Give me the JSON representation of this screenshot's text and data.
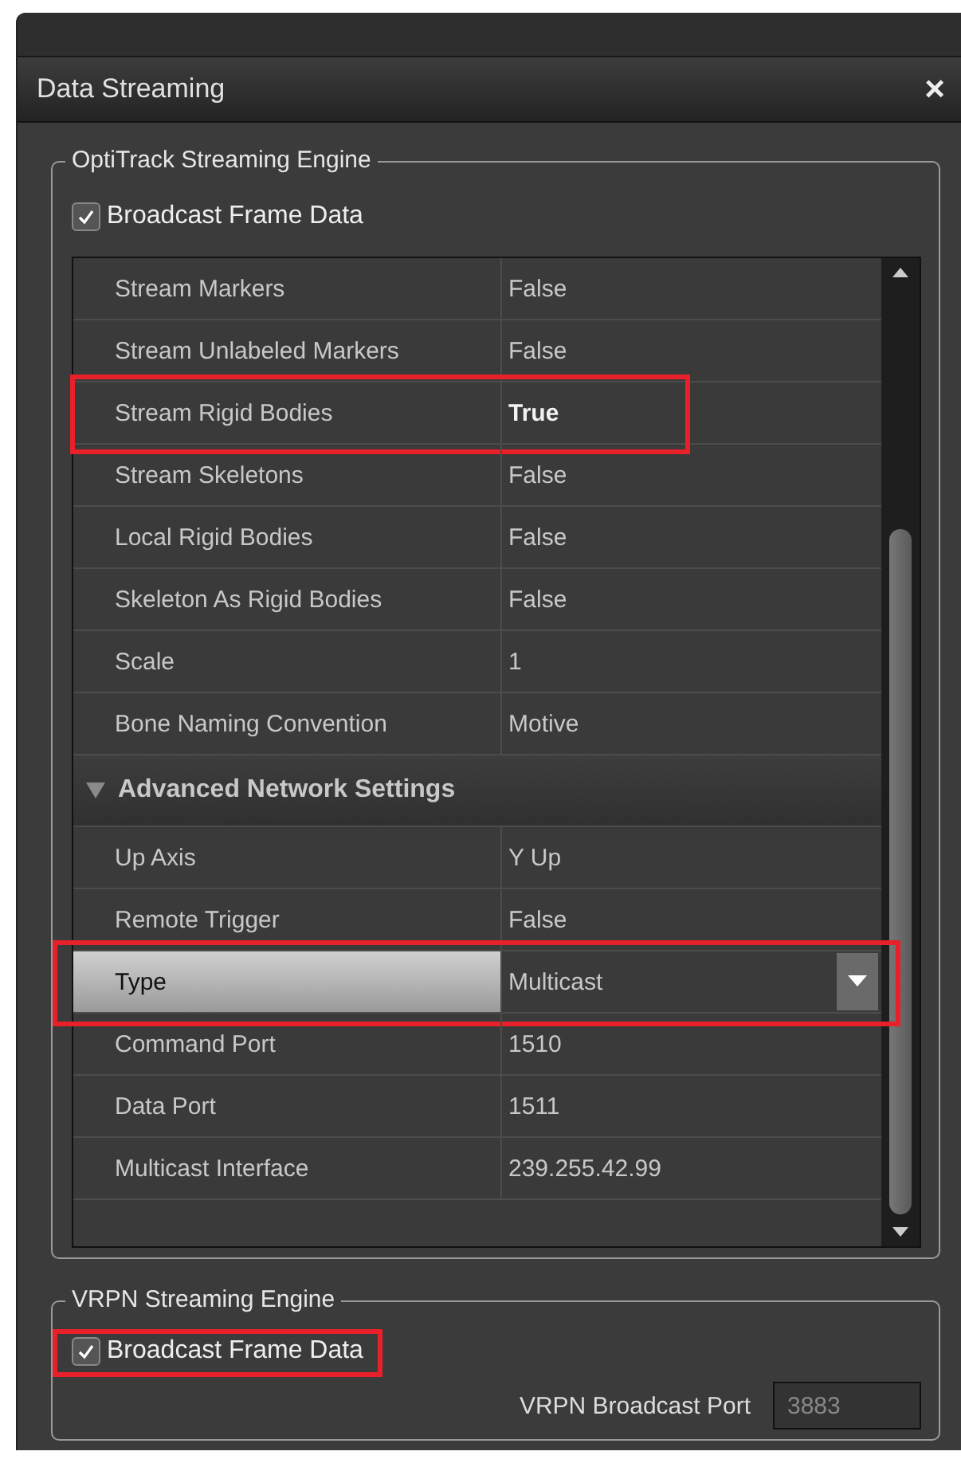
{
  "window": {
    "title": "Data Streaming",
    "close": "×"
  },
  "optitrack": {
    "title": "OptiTrack Streaming Engine",
    "broadcast": {
      "label": "Broadcast Frame Data",
      "checked": true,
      "highlighted": false
    },
    "rows": [
      {
        "kind": "property",
        "name": "Stream Markers",
        "value": "False",
        "bold": false,
        "highlighted": false,
        "selected": false
      },
      {
        "kind": "property",
        "name": "Stream Unlabeled Markers",
        "value": "False",
        "bold": false,
        "highlighted": false,
        "selected": false
      },
      {
        "kind": "property",
        "name": "Stream Rigid Bodies",
        "value": "True",
        "bold": true,
        "highlighted": true,
        "selected": false
      },
      {
        "kind": "property",
        "name": "Stream Skeletons",
        "value": "False",
        "bold": false,
        "highlighted": false,
        "selected": false
      },
      {
        "kind": "property",
        "name": "Local Rigid Bodies",
        "value": "False",
        "bold": false,
        "highlighted": false,
        "selected": false
      },
      {
        "kind": "property",
        "name": "Skeleton As Rigid Bodies",
        "value": "False",
        "bold": false,
        "highlighted": false,
        "selected": false
      },
      {
        "kind": "property",
        "name": "Scale",
        "value": "1",
        "bold": false,
        "highlighted": false,
        "selected": false
      },
      {
        "kind": "property",
        "name": "Bone Naming Convention",
        "value": "Motive",
        "bold": false,
        "highlighted": false,
        "selected": false
      },
      {
        "kind": "category",
        "name": "Advanced Network Settings",
        "expanded": true
      },
      {
        "kind": "property",
        "name": "Up Axis",
        "value": "Y Up",
        "bold": false,
        "highlighted": false,
        "selected": false
      },
      {
        "kind": "property",
        "name": "Remote Trigger",
        "value": "False",
        "bold": false,
        "highlighted": false,
        "selected": false
      },
      {
        "kind": "dropdown",
        "name": "Type",
        "value": "Multicast",
        "bold": false,
        "highlighted": true,
        "selected": true
      },
      {
        "kind": "property",
        "name": "Command Port",
        "value": "1510",
        "bold": false,
        "highlighted": false,
        "selected": false
      },
      {
        "kind": "property",
        "name": "Data Port",
        "value": "1511",
        "bold": false,
        "highlighted": false,
        "selected": false
      },
      {
        "kind": "property",
        "name": "Multicast Interface",
        "value": "239.255.42.99",
        "bold": false,
        "highlighted": false,
        "selected": false
      }
    ]
  },
  "vrpn": {
    "title": "VRPN Streaming Engine",
    "broadcast": {
      "label": "Broadcast Frame Data",
      "checked": true,
      "highlighted": true
    },
    "port": {
      "label": "VRPN Broadcast Port",
      "value": "3883",
      "disabled": true
    }
  }
}
